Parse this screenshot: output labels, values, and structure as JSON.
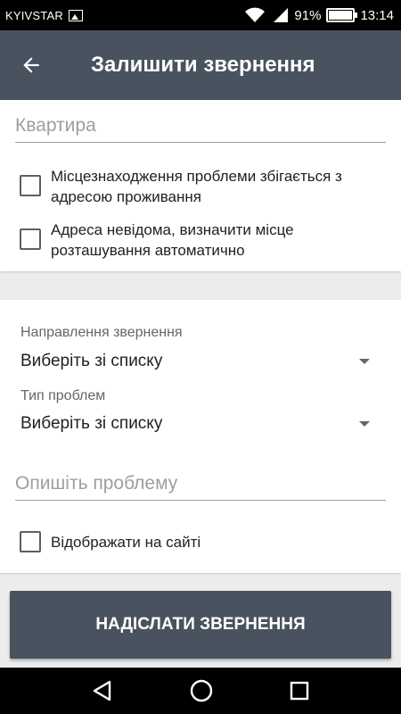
{
  "status_bar": {
    "carrier": "KYIVSTAR",
    "battery": "91%",
    "time": "13:14",
    "icons": [
      "image-icon",
      "wifi-icon",
      "signal-icon",
      "battery-icon"
    ]
  },
  "app_bar": {
    "title": "Залишити звернення",
    "back_icon": "arrow-left-icon"
  },
  "form": {
    "apartment_placeholder": "Квартира",
    "checkbox_same_address": "Місцезнаходження проблеми збігається з адресою проживання",
    "checkbox_unknown_address": "Адреса невідома, визначити місце розташування автоматично",
    "direction_label": "Направлення звернення",
    "direction_value": "Виберіть зі списку",
    "problem_type_label": "Тип проблем",
    "problem_type_value": "Виберіть зі списку",
    "description_placeholder": "Опишіть проблему",
    "checkbox_show_on_site": "Відображати на сайті"
  },
  "submit_label": "НАДІСЛАТИ ЗВЕРНЕННЯ",
  "nav_bar": {
    "icons": [
      "back-triangle-icon",
      "home-circle-icon",
      "recents-square-icon"
    ]
  },
  "colors": {
    "app_bar": "#48535f",
    "background": "#ececec",
    "card": "#ffffff"
  }
}
